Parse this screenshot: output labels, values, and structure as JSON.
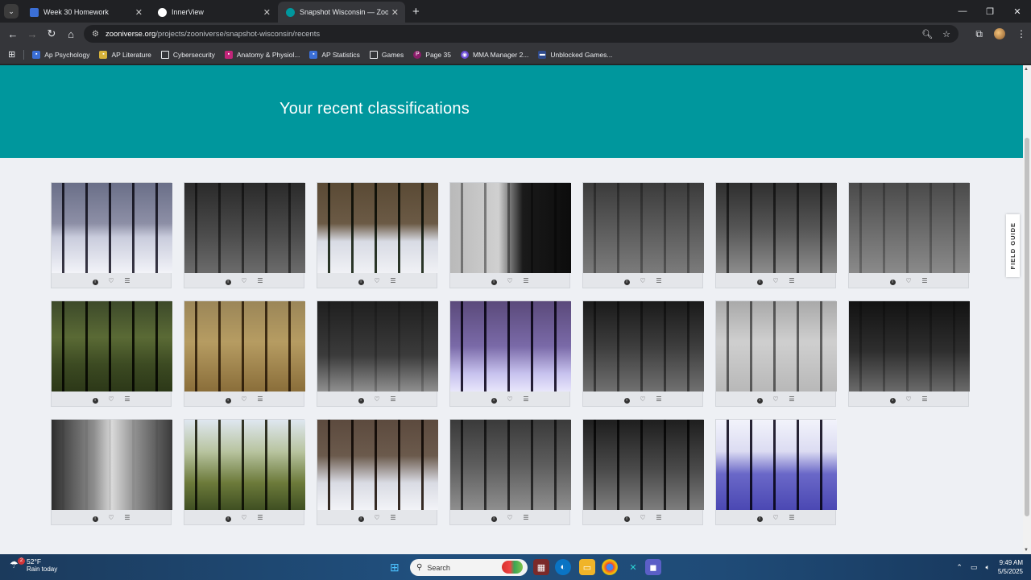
{
  "browser": {
    "tabs": [
      {
        "title": "Week 30 Homework",
        "favicon_color": "#3b6fd6",
        "active": false
      },
      {
        "title": "InnerView",
        "favicon_color": "#ffffff",
        "active": false
      },
      {
        "title": "Snapshot Wisconsin — Zooniverse",
        "favicon_color": "#00979d",
        "active": true
      }
    ],
    "url_host": "zooniverse.org",
    "url_path": "/projects/zooniverse/snapshot-wisconsin/recents",
    "bookmarks": [
      {
        "label": "Ap Psychology",
        "color": "#3b6fd6",
        "glyph": "👤"
      },
      {
        "label": "AP Literature",
        "color": "#d6b23b",
        "glyph": "👤"
      },
      {
        "label": "Cybersecurity",
        "color": "folder",
        "glyph": "🗀"
      },
      {
        "label": "Anatomy & Physiol...",
        "color": "#c2257a",
        "glyph": "👤"
      },
      {
        "label": "AP Statistics",
        "color": "#3b6fd6",
        "glyph": "👤"
      },
      {
        "label": "Games",
        "color": "folder",
        "glyph": "🗀"
      },
      {
        "label": "Page 35",
        "color": "#8c1d6b",
        "glyph": "P"
      },
      {
        "label": "MMA Manager 2...",
        "color": "#6b4bd6",
        "glyph": "◉"
      },
      {
        "label": "Unblocked Games...",
        "color": "#2e4a8c",
        "glyph": "▬"
      }
    ]
  },
  "page": {
    "heading": "Your recent classifications",
    "field_guide_label": "FIELD GUIDE"
  },
  "thumbnails": [
    {
      "bg": "linear-gradient(180deg,#6a6f88 0%,#8d8fa6 45%,#c9ccdc 60%,#f2f3f8 100%)",
      "trees": "#3a3845"
    },
    {
      "bg": "linear-gradient(180deg,#2a2a2a 0%,#4a4a4a 55%,#6b6b6b 100%)",
      "trees": "#777"
    },
    {
      "bg": "linear-gradient(180deg,#5a4a35 0%,#6b5a45 45%,#d8dbe4 65%,#f0f1f5 100%)",
      "trees": "#2e3a2a"
    },
    {
      "bg": "linear-gradient(90deg,#b9b9b9 0%,#d0d0d0 40%,#1a1a1a 60%,#0c0c0c 100%)",
      "trees": "#999"
    },
    {
      "bg": "linear-gradient(180deg,#3b3b3b 0%,#5e5e5e 55%,#7b7b7b 100%)",
      "trees": "#aaa"
    },
    {
      "bg": "linear-gradient(180deg,#2f2f2f 0%,#555 50%,#8c8c8c 100%)",
      "trees": "#666"
    },
    {
      "bg": "linear-gradient(180deg,#4a4a4a 0%,#6a6a6a 50%,#8a8a8a 100%)",
      "trees": "#bbb"
    },
    {
      "bg": "linear-gradient(180deg,#3d4a2a 0%,#5a6a35 40%,#3c4a22 70%,#2c3818 100%)",
      "trees": "#2a2a1a"
    },
    {
      "bg": "linear-gradient(180deg,#9b8658 0%,#b69c62 45%,#8a6e3a 100%)",
      "trees": "#5a4a32"
    },
    {
      "bg": "linear-gradient(180deg,#1f1f1f 0%,#3b3b3b 60%,#8f8f8f 100%)",
      "trees": "#c9c9c9"
    },
    {
      "bg": "linear-gradient(180deg,#5b4a7b 0%,#7a6aa8 50%,#c7c2ee 80%,#e8e6fb 100%)",
      "trees": "#2b2438"
    },
    {
      "bg": "linear-gradient(180deg,#1a1a1a 0%,#3d3d3d 50%,#707070 100%)",
      "trees": "#888"
    },
    {
      "bg": "linear-gradient(180deg,#a9a9a9 0%,#cfcfcf 45%,#b8b8b8 100%)",
      "trees": "#777"
    },
    {
      "bg": "linear-gradient(180deg,#121212 0%,#2e2e2e 55%,#6a6a6a 100%)",
      "trees": "#bbb"
    },
    {
      "bg": "linear-gradient(90deg,#2e2e2e 0%,#8d8d8d 35%,#d9d9d9 50%,#8d8d8d 70%,#3a3a3a 100%)",
      "trees": "#eee"
    },
    {
      "bg": "linear-gradient(180deg,#dfe7f0 0%,#b8c4a0 35%,#6c7a3a 70%,#3f4f22 100%)",
      "trees": "#3a3a2a"
    },
    {
      "bg": "linear-gradient(180deg,#5c4a3e 0%,#6b5a4c 40%,#d9dbe3 70%,#f2f3f7 100%)",
      "trees": "#3a2e26"
    },
    {
      "bg": "linear-gradient(180deg,#3a3a3a 0%,#5d5d5d 50%,#8e8e8e 100%)",
      "trees": "#555"
    },
    {
      "bg": "linear-gradient(180deg,#1e1e1e 0%,#4a4a4a 55%,#7c7c7c 100%)",
      "trees": "#3a3a3a"
    },
    {
      "bg": "linear-gradient(180deg,#f2f3fb 0%,#dcdcf2 35%,#6a68c8 60%,#4b48b3 100%)",
      "trees": "#2a2636"
    }
  ],
  "card_actions": {
    "info_glyph": "i",
    "favorite_glyph": "♡",
    "collections_glyph": "☰"
  },
  "taskbar": {
    "temperature": "52°F",
    "forecast": "Rain today",
    "weather_badge": "2",
    "search_label": "Search",
    "time": "9:49 AM",
    "date": "5/5/2025"
  }
}
